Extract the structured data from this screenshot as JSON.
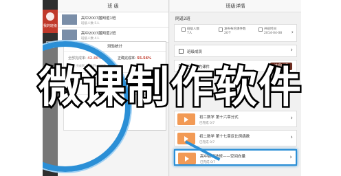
{
  "overlay": {
    "title": "微课制作软件"
  },
  "rail": {
    "active_label": "我的班级"
  },
  "class_pane": {
    "header": "班 级",
    "classes": [
      {
        "title": "高中2007届网道1班",
        "sub": "班级人数 5人"
      },
      {
        "title": "高中2007届网道2班",
        "sub": "班级人数 4人"
      }
    ]
  },
  "stats": {
    "title": "测验统计",
    "full_rate_label": "全部完成率:",
    "full_rate_value": "42.86%",
    "correct_rate_label": "正确完成率:",
    "correct_rate_value": "55.56%",
    "row1": "第1题  完成率: 42.86%   正确率: 66.67%"
  },
  "detail_pane": {
    "header": "班级详情",
    "class_name": "网道2班",
    "info": {
      "members_label": "班级人数",
      "members_value": "7人",
      "courses_label": "发布布的课件数",
      "courses_value": "20个",
      "created_label": "开班时间",
      "created_value": "2014-04-08"
    },
    "members_row": "班级成员",
    "published_row": "已发布的课件",
    "pick_time_button": "选择时间",
    "lessons": [
      {
        "title": "初二数学 第十六章分式",
        "meta_date": "已完成",
        "meta_count": "0/7"
      },
      {
        "title": "初二数学 第十七章反比例函数",
        "meta_date": "已完成",
        "meta_count": "0/7"
      },
      {
        "title": "高中数学选修——空间向量",
        "meta_date": "已完成",
        "meta_count": "0/7"
      }
    ]
  },
  "colors": {
    "accent": "#2b8fd6",
    "brand_red": "#c0392b",
    "lesson_orange": "#f29a55"
  }
}
